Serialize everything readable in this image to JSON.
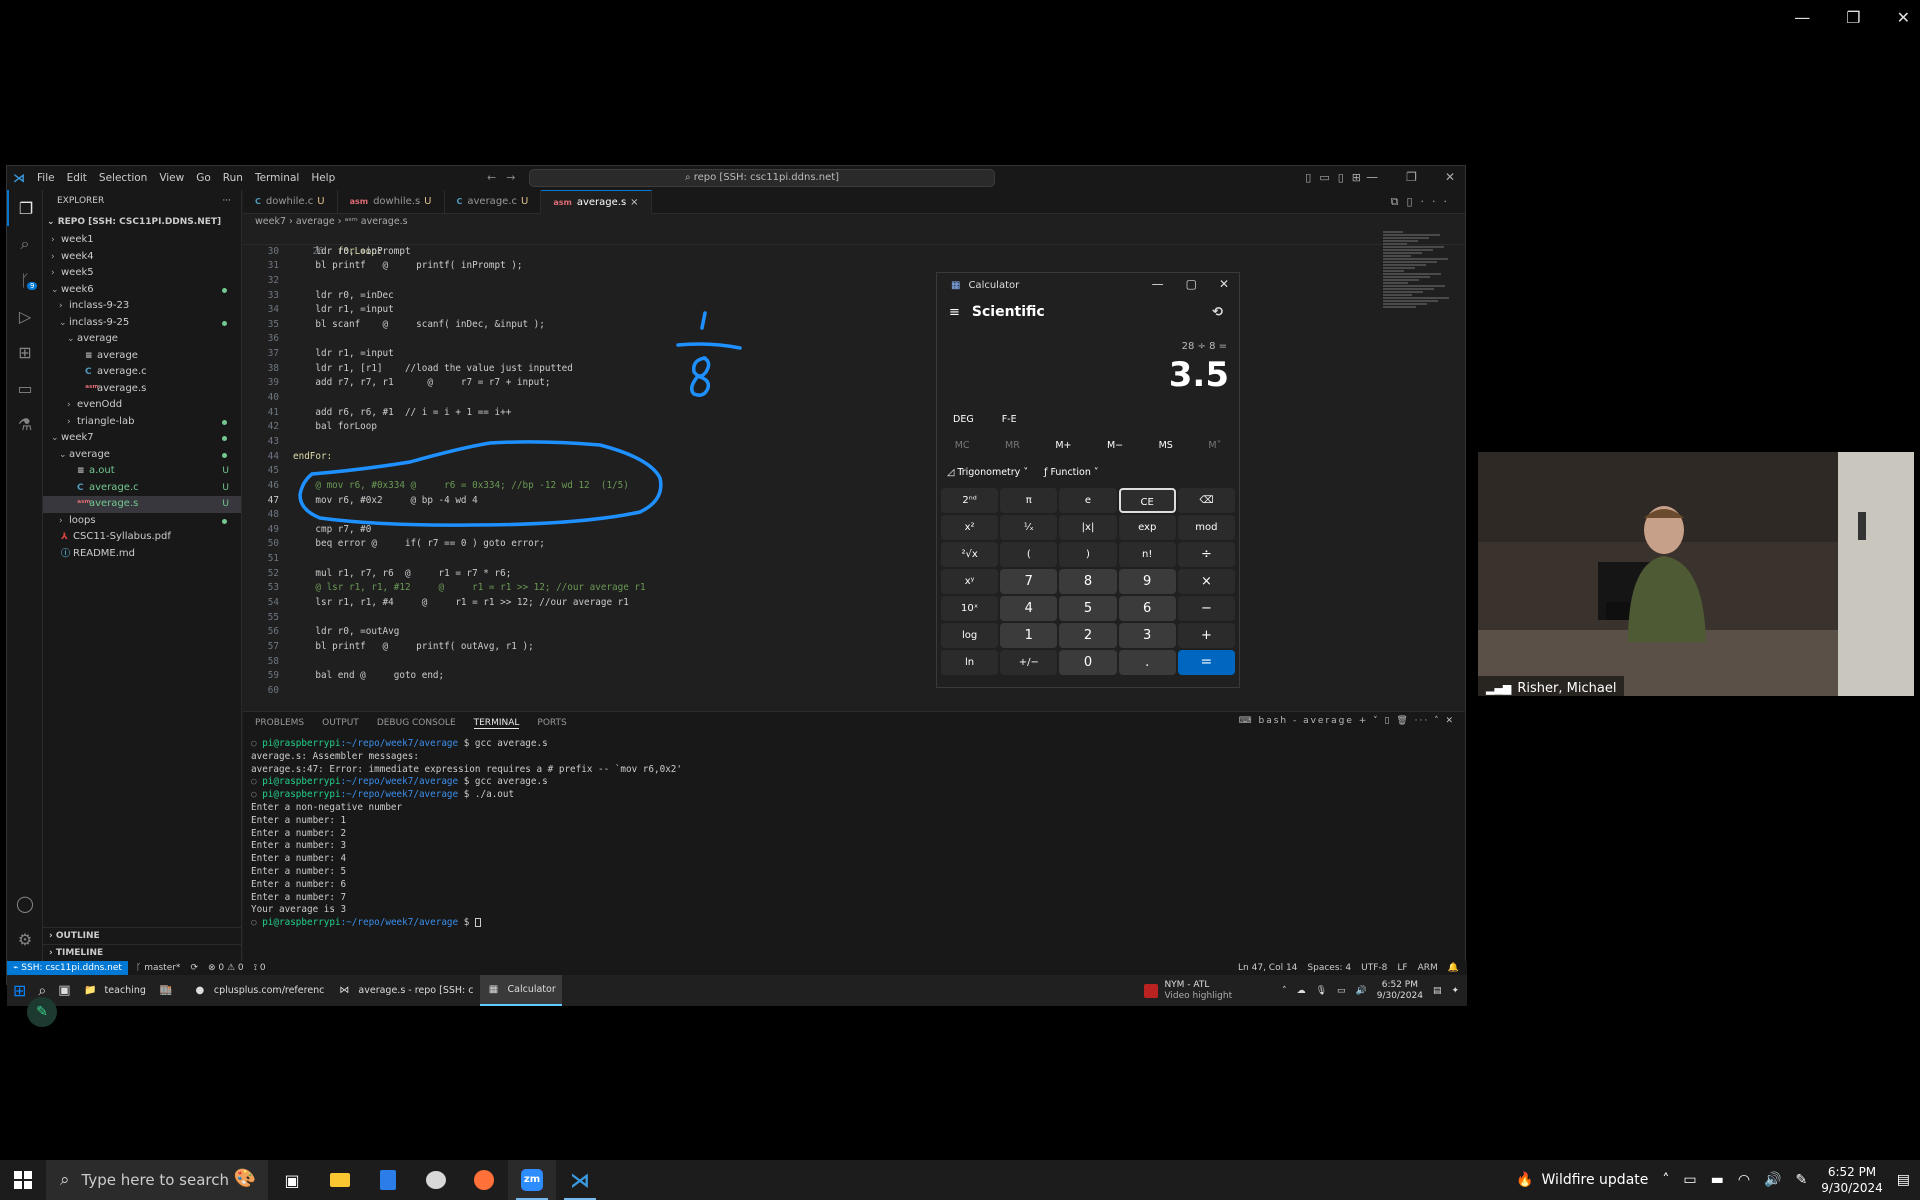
{
  "host_window": {
    "controls": [
      "—",
      "❐",
      "✕"
    ]
  },
  "vscode": {
    "menu": [
      "File",
      "Edit",
      "Selection",
      "View",
      "Go",
      "Run",
      "Terminal",
      "Help"
    ],
    "command_center": "⌕ repo [SSH: csc11pi.ddns.net]",
    "explorer_title": "EXPLORER",
    "explorer_more": "···",
    "repo_header": "REPO [SSH: CSC11PI.DDNS.NET]",
    "tree": [
      {
        "label": "week1",
        "depth": 1,
        "chev": "›",
        "icon": "",
        "status": ""
      },
      {
        "label": "week4",
        "depth": 1,
        "chev": "›",
        "icon": "",
        "status": ""
      },
      {
        "label": "week5",
        "depth": 1,
        "chev": "›",
        "icon": "",
        "status": ""
      },
      {
        "label": "week6",
        "depth": 1,
        "chev": "⌄",
        "icon": "",
        "status": "dot",
        "color": "green"
      },
      {
        "label": "inclass-9-23",
        "depth": 2,
        "chev": "›",
        "icon": "",
        "status": ""
      },
      {
        "label": "inclass-9-25",
        "depth": 2,
        "chev": "⌄",
        "icon": "",
        "status": "dot",
        "color": "green"
      },
      {
        "label": "average",
        "depth": 3,
        "chev": "⌄",
        "icon": "",
        "status": ""
      },
      {
        "label": "average",
        "depth": 4,
        "chev": "",
        "icon": "≡",
        "status": ""
      },
      {
        "label": "average.c",
        "depth": 4,
        "chev": "",
        "icon": "C",
        "status": ""
      },
      {
        "label": "average.s",
        "depth": 4,
        "chev": "",
        "icon": "ᵃˢᵐ",
        "status": ""
      },
      {
        "label": "evenOdd",
        "depth": 3,
        "chev": "›",
        "icon": "",
        "status": ""
      },
      {
        "label": "triangle-lab",
        "depth": 3,
        "chev": "›",
        "icon": "",
        "status": "dot",
        "color": "green"
      },
      {
        "label": "week7",
        "depth": 1,
        "chev": "⌄",
        "icon": "",
        "status": "dot",
        "color": "green"
      },
      {
        "label": "average",
        "depth": 2,
        "chev": "⌄",
        "icon": "",
        "status": "dot",
        "color": "green"
      },
      {
        "label": "a.out",
        "depth": 3,
        "chev": "",
        "icon": "≡",
        "status": "U"
      },
      {
        "label": "average.c",
        "depth": 3,
        "chev": "",
        "icon": "C",
        "status": "U"
      },
      {
        "label": "average.s",
        "depth": 3,
        "chev": "",
        "icon": "ᵃˢᵐ",
        "status": "U",
        "selected": true
      },
      {
        "label": "loops",
        "depth": 2,
        "chev": "›",
        "icon": "",
        "status": "dot",
        "color": "green"
      },
      {
        "label": "CSC11-Syllabus.pdf",
        "depth": 1,
        "chev": "",
        "icon": "⅄",
        "status": ""
      },
      {
        "label": "README.md",
        "depth": 1,
        "chev": "",
        "icon": "ⓘ",
        "status": ""
      }
    ],
    "outline_label": "OUTLINE",
    "timeline_label": "TIMELINE",
    "tabs": [
      {
        "icon": "C",
        "label": "dowhile.c",
        "status": "U"
      },
      {
        "icon": "asm",
        "label": "dowhile.s",
        "status": "U"
      },
      {
        "icon": "C",
        "label": "average.c",
        "status": "U"
      },
      {
        "icon": "asm",
        "label": "average.s",
        "status": "×",
        "active": true
      }
    ],
    "breadcrumb": "week7 › average › ᵃˢᵐ average.s",
    "sticky_line": {
      "num": "26",
      "text": "forLoop:"
    },
    "code_lines": [
      {
        "num": "30",
        "text": "    ldr r0, =inPrompt",
        "cls": "c-text"
      },
      {
        "num": "31",
        "text": "    bl printf   @     printf( inPrompt );",
        "cls": "c-text"
      },
      {
        "num": "32",
        "text": "",
        "cls": "c-text"
      },
      {
        "num": "33",
        "text": "    ldr r0, =inDec",
        "cls": "c-text"
      },
      {
        "num": "34",
        "text": "    ldr r1, =input",
        "cls": "c-text"
      },
      {
        "num": "35",
        "text": "    bl scanf    @     scanf( inDec, &input );",
        "cls": "c-text"
      },
      {
        "num": "36",
        "text": "",
        "cls": "c-text"
      },
      {
        "num": "37",
        "text": "    ldr r1, =input",
        "cls": "c-text"
      },
      {
        "num": "38",
        "text": "    ldr r1, [r1]    //load the value just inputted",
        "cls": "c-text"
      },
      {
        "num": "39",
        "text": "    add r7, r7, r1      @     r7 = r7 + input;",
        "cls": "c-text"
      },
      {
        "num": "40",
        "text": "",
        "cls": "c-text"
      },
      {
        "num": "41",
        "text": "    add r6, r6, #1  // i = i + 1 == i++",
        "cls": "c-text"
      },
      {
        "num": "42",
        "text": "    bal forLoop",
        "cls": "c-text"
      },
      {
        "num": "43",
        "text": "",
        "cls": "c-text"
      },
      {
        "num": "44",
        "text": "endFor:",
        "cls": "c-label"
      },
      {
        "num": "45",
        "text": "",
        "cls": "c-text"
      },
      {
        "num": "46",
        "text": "    @ mov r6, #0x334 @     r6 = 0x334; //bp -12 wd 12  (1/5)",
        "cls": "c-comment"
      },
      {
        "num": "47",
        "text": "    mov r6, #0x2     @ bp -4 wd 4",
        "cls": "c-text",
        "current": true
      },
      {
        "num": "48",
        "text": "",
        "cls": "c-text"
      },
      {
        "num": "49",
        "text": "    cmp r7, #0",
        "cls": "c-text"
      },
      {
        "num": "50",
        "text": "    beq error @     if( r7 == 0 ) goto error;",
        "cls": "c-text"
      },
      {
        "num": "51",
        "text": "",
        "cls": "c-text"
      },
      {
        "num": "52",
        "text": "    mul r1, r7, r6  @     r1 = r7 * r6;",
        "cls": "c-text"
      },
      {
        "num": "53",
        "text": "    @ lsr r1, r1, #12     @     r1 = r1 >> 12; //our average r1",
        "cls": "c-comment"
      },
      {
        "num": "54",
        "text": "    lsr r1, r1, #4     @     r1 = r1 >> 12; //our average r1",
        "cls": "c-text"
      },
      {
        "num": "55",
        "text": "",
        "cls": "c-text"
      },
      {
        "num": "56",
        "text": "    ldr r0, =outAvg",
        "cls": "c-text"
      },
      {
        "num": "57",
        "text": "    bl printf   @     printf( outAvg, r1 );",
        "cls": "c-text"
      },
      {
        "num": "58",
        "text": "",
        "cls": "c-text"
      },
      {
        "num": "59",
        "text": "    bal end @     goto end;",
        "cls": "c-text"
      },
      {
        "num": "60",
        "text": "",
        "cls": "c-text"
      }
    ],
    "panel_tabs": [
      "PROBLEMS",
      "OUTPUT",
      "DEBUG CONSOLE",
      "TERMINAL",
      "PORTS"
    ],
    "panel_active": "TERMINAL",
    "terminal_instance": "bash - average",
    "terminal_lines": [
      {
        "prompt": true,
        "user": "pi@raspberrypi",
        "path": ":~/repo/week7/average",
        "cmd": " $ gcc average.s"
      },
      {
        "prompt": false,
        "text": "average.s: Assembler messages:"
      },
      {
        "prompt": false,
        "text": "average.s:47: Error: immediate expression requires a # prefix -- `mov r6,0x2'"
      },
      {
        "prompt": true,
        "user": "pi@raspberrypi",
        "path": ":~/repo/week7/average",
        "cmd": " $ gcc average.s"
      },
      {
        "prompt": true,
        "user": "pi@raspberrypi",
        "path": ":~/repo/week7/average",
        "cmd": " $ ./a.out"
      },
      {
        "prompt": false,
        "text": "Enter a non-negative number"
      },
      {
        "prompt": false,
        "text": "Enter a number: 1"
      },
      {
        "prompt": false,
        "text": "Enter a number: 2"
      },
      {
        "prompt": false,
        "text": "Enter a number: 3"
      },
      {
        "prompt": false,
        "text": "Enter a number: 4"
      },
      {
        "prompt": false,
        "text": "Enter a number: 5"
      },
      {
        "prompt": false,
        "text": "Enter a number: 6"
      },
      {
        "prompt": false,
        "text": "Enter a number: 7"
      },
      {
        "prompt": false,
        "text": "Your average is 3"
      },
      {
        "prompt": true,
        "user": "pi@raspberrypi",
        "path": ":~/repo/week7/average",
        "cmd": " $ ",
        "cursor": true
      }
    ],
    "status": {
      "remote": "⌁ SSH: csc11pi.ddns.net",
      "branch": "ᚴ master*",
      "sync": "⟳",
      "problems": "⊗ 0 ⚠ 0",
      "ports": "⟟ 0",
      "position": "Ln 47, Col 14",
      "spaces": "Spaces: 4",
      "encoding": "UTF-8",
      "eol": "LF",
      "language": "ARM",
      "bell": "🔔"
    },
    "inner_taskbar": {
      "items": [
        {
          "label": "teaching",
          "icon": "📁"
        },
        {
          "label": "",
          "icon": "🏬"
        },
        {
          "label": "cplusplus.com/referenc",
          "icon": "●"
        },
        {
          "label": "average.s - repo [SSH: c",
          "icon": "⋈"
        },
        {
          "label": "Calculator",
          "icon": "▦",
          "active": true
        }
      ],
      "news": "NYM - ATL",
      "news_sub": "Video highlight",
      "time": "6:52 PM",
      "date": "9/30/2024"
    }
  },
  "calculator": {
    "title": "Calculator",
    "mode": "Scientific",
    "expression": "28 ÷ 8 =",
    "display": "3.5",
    "angle": "DEG",
    "fe": "F-E",
    "memory": [
      "MC",
      "MR",
      "M+",
      "M−",
      "MS",
      "M˅"
    ],
    "trig_label": "Trigonometry ˅",
    "func_label": "Function ˅",
    "keys": [
      {
        "label": "2ⁿᵈ",
        "type": "fn"
      },
      {
        "label": "π",
        "type": "fn"
      },
      {
        "label": "e",
        "type": "fn"
      },
      {
        "label": "CE",
        "type": "ce"
      },
      {
        "label": "⌫",
        "type": "fn"
      },
      {
        "label": "x²",
        "type": "fn"
      },
      {
        "label": "¹⁄ₓ",
        "type": "fn"
      },
      {
        "label": "|x|",
        "type": "fn"
      },
      {
        "label": "exp",
        "type": "fn"
      },
      {
        "label": "mod",
        "type": "fn"
      },
      {
        "label": "²√x",
        "type": "fn"
      },
      {
        "label": "(",
        "type": "fn"
      },
      {
        "label": ")",
        "type": "fn"
      },
      {
        "label": "n!",
        "type": "fn"
      },
      {
        "label": "÷",
        "type": "op"
      },
      {
        "label": "xʸ",
        "type": "fn"
      },
      {
        "label": "7",
        "type": "num"
      },
      {
        "label": "8",
        "type": "num"
      },
      {
        "label": "9",
        "type": "num"
      },
      {
        "label": "×",
        "type": "op"
      },
      {
        "label": "10ˣ",
        "type": "fn"
      },
      {
        "label": "4",
        "type": "num"
      },
      {
        "label": "5",
        "type": "num"
      },
      {
        "label": "6",
        "type": "num"
      },
      {
        "label": "−",
        "type": "op"
      },
      {
        "label": "log",
        "type": "fn"
      },
      {
        "label": "1",
        "type": "num"
      },
      {
        "label": "2",
        "type": "num"
      },
      {
        "label": "3",
        "type": "num"
      },
      {
        "label": "+",
        "type": "op"
      },
      {
        "label": "ln",
        "type": "fn"
      },
      {
        "label": "+/−",
        "type": "fn"
      },
      {
        "label": "0",
        "type": "num"
      },
      {
        "label": ".",
        "type": "num"
      },
      {
        "label": "=",
        "type": "eq"
      }
    ]
  },
  "video": {
    "name": "Risher, Michael"
  },
  "taskbar": {
    "search_placeholder": "Type here to search",
    "apps": [
      "task-view",
      "file-explorer",
      "calculator",
      "snipping",
      "firefox",
      "zoom",
      "vscode"
    ],
    "notification": "Wildfire update",
    "time": "6:52 PM",
    "date": "9/30/2024"
  }
}
